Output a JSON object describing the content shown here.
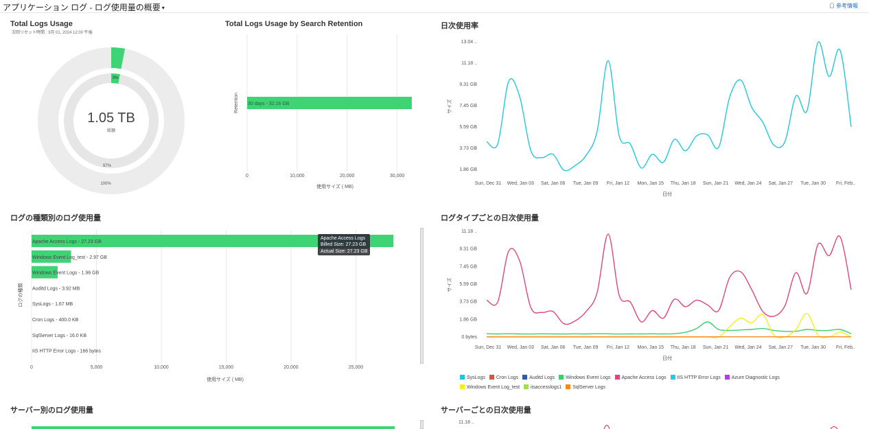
{
  "header": {
    "title": "アプリケーション ログ - ログ使用量の概要",
    "help_label": "参考情報"
  },
  "total_usage": {
    "title": "Total Logs Usage",
    "subtitle": "次回リセット時間 : 3月 01, 2024 12:00 午後",
    "center_value": "1.05 TB",
    "center_label": "総額",
    "inner_pct_label": "3%",
    "remain_pct_label": "97%",
    "outer_pct_label": "100%"
  },
  "retention": {
    "title": "Total Logs Usage by Search Retention",
    "y_axis_label": "Retention",
    "x_axis_label": "使用サイズ ( MB)",
    "bar_label": "30 days - 32.16 GB"
  },
  "daily_usage": {
    "title": "日次使用率",
    "y_axis_label": "サイズ",
    "x_axis_label": "日付"
  },
  "by_type": {
    "title": "ログの種類別のログ使用量",
    "y_axis_label": "ログの種類",
    "x_axis_label": "使用サイズ ( MB)",
    "tooltip": {
      "name": "Apache Access Logs",
      "billed": "Billed Size: 27.23 GB",
      "actual": "Actual Size: 27.23 GB"
    }
  },
  "daily_by_type": {
    "title": "ログタイプごとの日次使用量",
    "y_axis_label": "サイズ",
    "x_axis_label": "日付"
  },
  "by_server": {
    "title": "サーバー別のログ使用量"
  },
  "daily_by_server": {
    "title": "サーバーごとの日次使用量",
    "y_tick": "11.18 .."
  },
  "legend": [
    {
      "name": "SysLogs",
      "color": "#1ec6e0"
    },
    {
      "name": "Cron Logs",
      "color": "#e0503c"
    },
    {
      "name": "Auditd Logs",
      "color": "#2a5bb5"
    },
    {
      "name": "Windows Event Logs",
      "color": "#35d16a"
    },
    {
      "name": "Apache Access Logs",
      "color": "#e0457b"
    },
    {
      "name": "IIS HTTP Error Logs",
      "color": "#27c9e8"
    },
    {
      "name": "Azure Diagnostic Logs",
      "color": "#b040e0"
    },
    {
      "name": "Windows Event Log_test",
      "color": "#f5ee1c"
    },
    {
      "name": "iisaccesslogs1",
      "color": "#9be83a"
    },
    {
      "name": "SqlServer Logs",
      "color": "#f08c1a"
    }
  ],
  "chart_data": [
    {
      "type": "pie",
      "title": "Total Logs Usage",
      "slices": [
        {
          "label": "3%",
          "value": 3,
          "color": "#3ed374"
        },
        {
          "label": "97%",
          "value": 97,
          "color": "#ececec"
        }
      ],
      "outer_ring": [
        {
          "label": "100%",
          "value": 100,
          "color": "#ececec"
        }
      ]
    },
    {
      "type": "bar",
      "title": "Total Logs Usage by Search Retention",
      "orientation": "horizontal",
      "categories": [
        "30 days - 32.16 GB"
      ],
      "values": [
        32930
      ],
      "xlabel": "使用サイズ ( MB)",
      "ylabel": "Retention",
      "xlim": [
        0,
        35000
      ],
      "x_ticks": [
        "0",
        "10,000",
        "20,000",
        "30,000"
      ],
      "color": "#3ed374"
    },
    {
      "type": "line",
      "title": "日次使用率",
      "xlabel": "日付",
      "ylabel": "サイズ",
      "y_ticks": [
        "1.86 GB",
        "3.73 GB",
        "5.59 GB",
        "7.45 GB",
        "9.31 GB",
        "11.18 ..",
        "13.04 .."
      ],
      "ylim": [
        1.86,
        13.04
      ],
      "x_ticks": [
        "Sun, Dec 31",
        "Wed, Jan 03",
        "Sat, Jan 06",
        "Tue, Jan 09",
        "Fri, Jan 12",
        "Mon, Jan 15",
        "Thu, Jan 18",
        "Sun, Jan 21",
        "Wed, Jan 24",
        "Sat, Jan 27",
        "Tue, Jan 30",
        "Fri, Feb.."
      ],
      "series": [
        {
          "color": "#22c7dc",
          "values": [
            4.3,
            4.1,
            9.6,
            8.2,
            3.5,
            2.9,
            3.2,
            1.8,
            2.2,
            3.1,
            5.2,
            11.4,
            4.8,
            4.1,
            2.0,
            3.2,
            2.5,
            4.5,
            3.5,
            4.8,
            4.9,
            3.8,
            8.2,
            9.7,
            7.3,
            6.0,
            4.0,
            4.3,
            8.3,
            7.0,
            13.0,
            10.0,
            12.3,
            5.6
          ]
        }
      ]
    },
    {
      "type": "bar",
      "title": "ログの種類別のログ使用量",
      "orientation": "horizontal",
      "xlabel": "使用サイズ ( MB)",
      "ylabel": "ログの種類",
      "xlim": [
        0,
        30000
      ],
      "x_ticks": [
        "0",
        "5,000",
        "10,000",
        "15,000",
        "20,000",
        "25,000"
      ],
      "categories": [
        "Apache Access Logs - 27.23 GB",
        "Windows Event Log_test - 2.97 GB",
        "Windows Event Logs - 1.96 GB",
        "Auditd Logs - 3.92 MB",
        "SysLogs - 1.67 MB",
        "Cron Logs - 400.0 KB",
        "SqlServer Logs - 16.0 KB",
        "IIS HTTP Error Logs - 166 bytes"
      ],
      "values": [
        27883,
        3041,
        2007,
        3.92,
        1.67,
        0.39,
        0.016,
        0.0002
      ],
      "color": "#3ed374"
    },
    {
      "type": "line",
      "title": "ログタイプごとの日次使用量",
      "xlabel": "日付",
      "ylabel": "サイズ",
      "y_ticks": [
        "0 bytes",
        "1.86 GB",
        "3.73 GB",
        "5.59 GB",
        "7.45 GB",
        "9.31 GB",
        "11.18 .."
      ],
      "ylim": [
        0,
        11.18
      ],
      "x_ticks": [
        "Sun, Dec 31",
        "Wed, Jan 03",
        "Sat, Jan 06",
        "Tue, Jan 09",
        "Fri, Jan 12",
        "Mon, Jan 15",
        "Thu, Jan 18",
        "Sun, Jan 21",
        "Wed, Jan 24",
        "Sat, Jan 27",
        "Tue, Jan 30",
        "Fri, Feb.."
      ],
      "series": [
        {
          "name": "Apache Access Logs",
          "color": "#e0457b",
          "values": [
            3.9,
            3.7,
            9.1,
            8.0,
            3.1,
            2.6,
            2.7,
            1.4,
            1.7,
            2.7,
            4.7,
            10.9,
            4.4,
            3.7,
            1.6,
            2.8,
            2.0,
            4.0,
            3.2,
            3.9,
            3.4,
            2.8,
            6.3,
            6.9,
            5.0,
            2.7,
            2.2,
            3.3,
            6.8,
            4.6,
            9.8,
            8.6,
            10.6,
            5.0
          ]
        },
        {
          "name": "Windows Event Logs",
          "color": "#35d16a",
          "values": [
            0.35,
            0.33,
            0.35,
            0.33,
            0.32,
            0.34,
            0.33,
            0.32,
            0.34,
            0.33,
            0.35,
            0.34,
            0.32,
            0.33,
            0.33,
            0.34,
            0.33,
            0.35,
            0.5,
            0.9,
            1.6,
            0.8,
            0.7,
            0.75,
            0.8,
            0.9,
            0.7,
            0.6,
            0.6,
            0.8,
            0.7,
            0.7,
            0.8,
            0.35
          ]
        },
        {
          "name": "Windows Event Log_test",
          "color": "#f5ee1c",
          "values": [
            0,
            0,
            0,
            0,
            0,
            0,
            0,
            0,
            0,
            0,
            0,
            0,
            0,
            0,
            0,
            0,
            0,
            0,
            0,
            0,
            0,
            0,
            1.1,
            2.0,
            1.5,
            2.4,
            0.2,
            0,
            0.8,
            2.5,
            0.2,
            0,
            0.5,
            0
          ]
        },
        {
          "name": "SqlServer Logs",
          "color": "#f08c1a",
          "values": [
            0.02,
            0.02,
            0.02,
            0.02,
            0.02,
            0.02,
            0.02,
            0.02,
            0.02,
            0.02,
            0.02,
            0.02,
            0.02,
            0.02,
            0.02,
            0.02,
            0.02,
            0.02,
            0.02,
            0.02,
            0.02,
            0.02,
            0.02,
            0.02,
            0.02,
            0.02,
            0.02,
            0.02,
            0.02,
            0.02,
            0.02,
            0.02,
            0.02,
            0.02
          ]
        }
      ]
    }
  ]
}
